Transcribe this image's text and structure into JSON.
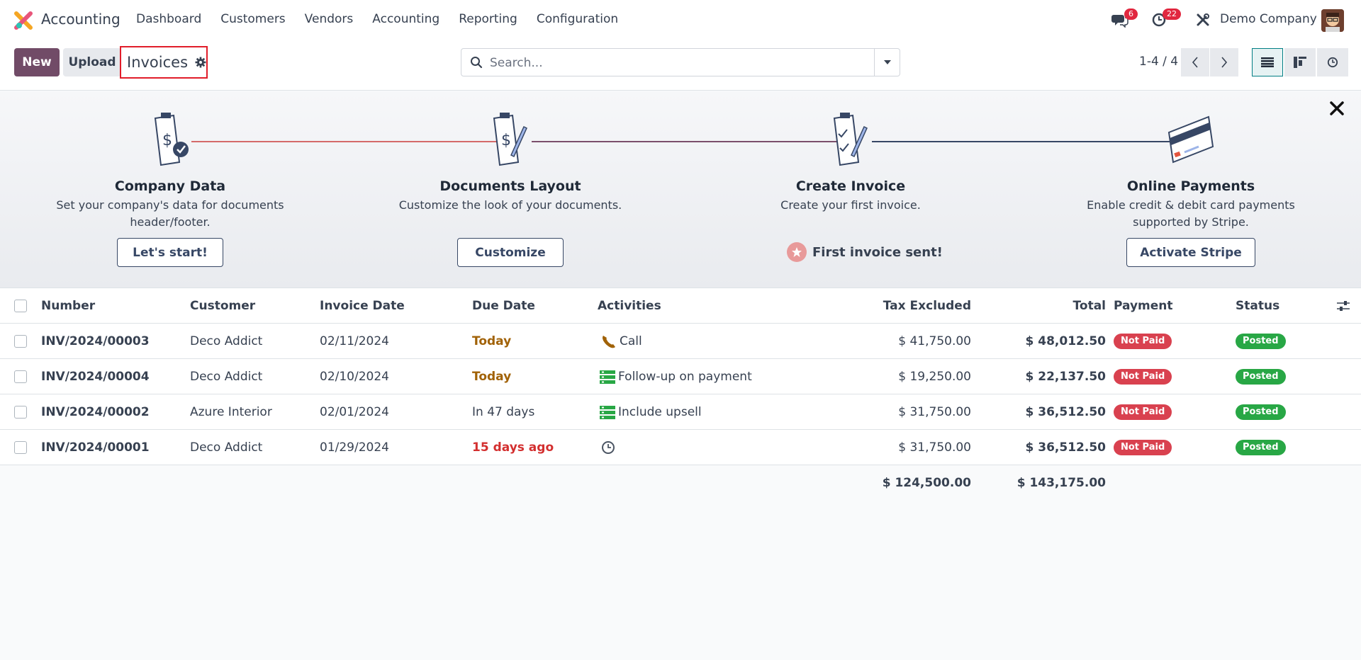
{
  "app": {
    "name": "Accounting"
  },
  "menu": [
    "Dashboard",
    "Customers",
    "Vendors",
    "Accounting",
    "Reporting",
    "Configuration"
  ],
  "systray": {
    "messages_count": "6",
    "activities_count": "22",
    "company": "Demo Company"
  },
  "control_panel": {
    "new_label": "New",
    "upload_label": "Upload",
    "breadcrumb": "Invoices",
    "search_placeholder": "Search...",
    "pager": "1-4 / 4"
  },
  "onboarding": {
    "steps": [
      {
        "title": "Company Data",
        "desc": "Set your company's data for documents header/footer.",
        "button": "Let's start!"
      },
      {
        "title": "Documents Layout",
        "desc": "Customize the look of your documents.",
        "button": "Customize"
      },
      {
        "title": "Create Invoice",
        "desc": "Create your first invoice.",
        "done_text": "First invoice sent!"
      },
      {
        "title": "Online Payments",
        "desc": "Enable credit & debit card payments supported by Stripe.",
        "button": "Activate Stripe"
      }
    ]
  },
  "table": {
    "columns": [
      "Number",
      "Customer",
      "Invoice Date",
      "Due Date",
      "Activities",
      "Tax Excluded",
      "Total",
      "Payment",
      "Status"
    ],
    "rows": [
      {
        "number": "INV/2024/00003",
        "customer": "Deco Addict",
        "invoice_date": "02/11/2024",
        "due_date": "Today",
        "due_style": "today",
        "activity_icon": "phone-icon",
        "activity": "Call",
        "tax_excluded": "$ 41,750.00",
        "total": "$ 48,012.50",
        "payment": "Not Paid",
        "status": "Posted"
      },
      {
        "number": "INV/2024/00004",
        "customer": "Deco Addict",
        "invoice_date": "02/10/2024",
        "due_date": "Today",
        "due_style": "today",
        "activity_icon": "tasks-icon",
        "activity": "Follow-up on payment",
        "tax_excluded": "$ 19,250.00",
        "total": "$ 22,137.50",
        "payment": "Not Paid",
        "status": "Posted"
      },
      {
        "number": "INV/2024/00002",
        "customer": "Azure Interior",
        "invoice_date": "02/01/2024",
        "due_date": "In 47 days",
        "due_style": "normal",
        "activity_icon": "tasks-icon",
        "activity": "Include upsell",
        "tax_excluded": "$ 31,750.00",
        "total": "$ 36,512.50",
        "payment": "Not Paid",
        "status": "Posted"
      },
      {
        "number": "INV/2024/00001",
        "customer": "Deco Addict",
        "invoice_date": "01/29/2024",
        "due_date": "15 days ago",
        "due_style": "overdue",
        "activity_icon": "clock-icon",
        "activity": "",
        "tax_excluded": "$ 31,750.00",
        "total": "$ 36,512.50",
        "payment": "Not Paid",
        "status": "Posted"
      }
    ],
    "totals": {
      "tax_excluded": "$ 124,500.00",
      "total": "$ 143,175.00"
    }
  },
  "colors": {
    "brand": "#714b67",
    "accent": "#017e84",
    "not_paid": "#d9414f",
    "posted": "#28a745",
    "today": "#a16207",
    "overdue": "#d32f2f"
  }
}
